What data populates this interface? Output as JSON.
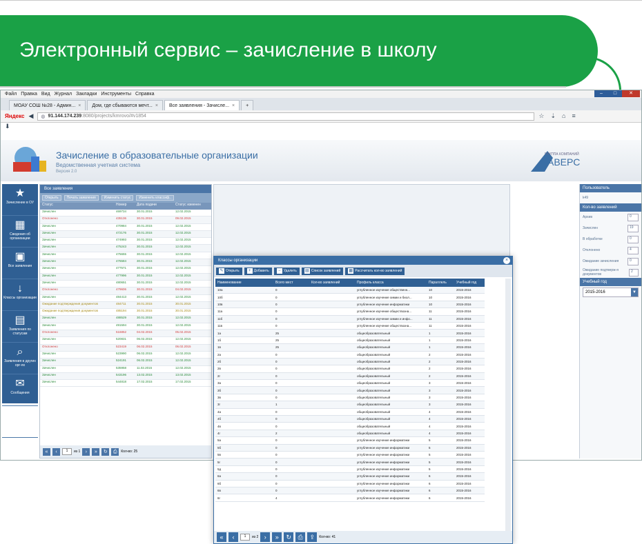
{
  "slide_title": "Электронный сервис – зачисление в школу",
  "browser": {
    "menu": [
      "Файл",
      "Правка",
      "Вид",
      "Журнал",
      "Закладки",
      "Инструменты",
      "Справка"
    ],
    "tabs": [
      "МОАУ СОШ №28 - Админ...",
      "Дом, где сбываются мечт...",
      "Все заявления - Зачисле..."
    ],
    "address_brand": "Яндекс",
    "url_host": "91.144.174.239",
    "url_path": ":8080/projects/kmrovo/#v1854"
  },
  "app": {
    "title": "Зачисление в образовательные организации",
    "subtitle": "Ведомственная учетная система",
    "version": "Версия 2.0",
    "avers_label": "ГРУППА КОМПАНИЙ",
    "avers_name": "АВЕРС"
  },
  "sidebar": [
    {
      "icon": "★",
      "label": "Зачисление в ОУ"
    },
    {
      "icon": "▦",
      "label": "Сведения об организации"
    },
    {
      "icon": "▣",
      "label": "Все заявления"
    },
    {
      "icon": "↓",
      "label": "Классы организации"
    },
    {
      "icon": "▤",
      "label": "Заявления по статусам"
    },
    {
      "icon": "⌕",
      "label": "Заявления в других орг-ях"
    },
    {
      "icon": "✉",
      "label": "Сообщения"
    },
    {
      "icon": "⇥",
      "label": "Выход"
    }
  ],
  "left_panel": {
    "header": "Все заявления",
    "tools": [
      "Открыть",
      "Печать заявления",
      "Изменить статус",
      "Изменить классиф.."
    ],
    "cols": [
      "Статус",
      "Номер",
      "Дата подачи",
      "Статус изменен"
    ],
    "rows": [
      [
        "Зачислен",
        "469734",
        "30.01.2015",
        "12.02.2015",
        "ok"
      ],
      [
        "Отклонено",
        "435136",
        "30.01.2015",
        "09.02.2015",
        "bad"
      ],
      [
        "Зачислен",
        "470984",
        "30.01.2015",
        "12.02.2015",
        "ok"
      ],
      [
        "Зачислен",
        "472176",
        "30.01.2015",
        "12.02.2015",
        "ok"
      ],
      [
        "Зачислен",
        "474993",
        "30.01.2015",
        "12.02.2015",
        "ok"
      ],
      [
        "Зачислен",
        "475243",
        "30.01.2015",
        "12.02.2015",
        "ok"
      ],
      [
        "Зачислен",
        "475655",
        "30.01.2015",
        "12.02.2015",
        "ok"
      ],
      [
        "Зачислен",
        "476584",
        "30.01.2015",
        "12.02.2015",
        "ok"
      ],
      [
        "Зачислен",
        "477571",
        "30.01.2015",
        "12.02.2015",
        "ok"
      ],
      [
        "Зачислен",
        "477996",
        "30.01.2015",
        "12.02.2015",
        "ok"
      ],
      [
        "Зачислен",
        "480651",
        "30.01.2015",
        "12.02.2015",
        "ok"
      ],
      [
        "Отклонено",
        "479606",
        "30.01.2015",
        "04.02.2015",
        "bad"
      ],
      [
        "Зачислен",
        "484413",
        "30.01.2015",
        "12.02.2015",
        "ok"
      ],
      [
        "Ожидание подтверждения документов",
        "484711",
        "30.01.2015",
        "30.01.2015",
        "wait"
      ],
      [
        "Ожидание подтверждения документов",
        "485194",
        "30.01.2015",
        "30.01.2015",
        "wait"
      ],
      [
        "Зачислен",
        "488529",
        "30.01.2015",
        "12.02.2015",
        "ok"
      ],
      [
        "Зачислен",
        "491594",
        "30.01.2015",
        "12.02.2015",
        "ok"
      ],
      [
        "Отклонено",
        "516852",
        "04.02.2015",
        "05.02.2015",
        "bad"
      ],
      [
        "Зачислен",
        "520831",
        "06.02.2015",
        "12.02.2015",
        "ok"
      ],
      [
        "Отклонено",
        "523419",
        "06.02.2015",
        "06.02.2015",
        "bad"
      ],
      [
        "Зачислен",
        "523990",
        "06.02.2015",
        "12.02.2015",
        "ok"
      ],
      [
        "Зачислен",
        "524191",
        "06.02.2015",
        "12.02.2015",
        "ok"
      ],
      [
        "Зачислен",
        "535958",
        "11.02.2015",
        "12.02.2015",
        "ok"
      ],
      [
        "Зачислен",
        "543196",
        "13.02.2015",
        "13.02.2015",
        "ok"
      ],
      [
        "Зачислен",
        "544818",
        "17.02.2015",
        "17.02.2015",
        "ok"
      ]
    ],
    "pager_page": "1",
    "pager_of": "из 1",
    "pager_count": "Кол-во: 25"
  },
  "right_panel": {
    "user_head": "Пользователь",
    "user": "k49",
    "count_head": "Кол-во заявлений",
    "counts": [
      [
        "Архив",
        "0"
      ],
      [
        "Зачислен",
        "19"
      ],
      [
        "В обработке",
        "0"
      ],
      [
        "Отклонено",
        "4"
      ],
      [
        "Ожидание зачисления",
        "0"
      ],
      [
        "Ожидание подтверж-я документов",
        "2"
      ]
    ],
    "year_head": "Учебный год",
    "year": "2015-2016"
  },
  "modal": {
    "title": "Классы организации",
    "tools": [
      "Открыть",
      "Добавить",
      "Удалить",
      "Список заявлений",
      "Рассчитать кол-во заявлений"
    ],
    "cols": [
      "Наименование",
      "Всего мест",
      "Кол-во заявлений",
      "Профиль класса",
      "Параллель",
      "Учебный год"
    ],
    "rows": [
      [
        "10а",
        "0",
        "",
        "углубленное изучение общественн...",
        "10",
        "2015-2016"
      ],
      [
        "10б",
        "0",
        "",
        "углубленное изучение химии и биол...",
        "10",
        "2015-2016"
      ],
      [
        "10в",
        "0",
        "",
        "углубленное изучение информатики",
        "10",
        "2015-2016"
      ],
      [
        "11а",
        "0",
        "",
        "углубленное изучение обществозна...",
        "11",
        "2015-2016"
      ],
      [
        "11б",
        "0",
        "",
        "углубленное изучение химии и инфо...",
        "11",
        "2015-2016"
      ],
      [
        "11в",
        "0",
        "",
        "углубленное изучение обществозна...",
        "11",
        "2015-2016"
      ],
      [
        "1а",
        "25",
        "",
        "общеобразовательный",
        "1",
        "2015-2016"
      ],
      [
        "1б",
        "25",
        "",
        "общеобразовательный",
        "1",
        "2015-2016"
      ],
      [
        "1в",
        "25",
        "",
        "общеобразовательный",
        "1",
        "2015-2016"
      ],
      [
        "2а",
        "0",
        "",
        "общеобразовательный",
        "2",
        "2015-2016"
      ],
      [
        "2б",
        "0",
        "",
        "общеобразовательный",
        "2",
        "2015-2016"
      ],
      [
        "2в",
        "0",
        "",
        "общеобразовательный",
        "2",
        "2015-2016"
      ],
      [
        "2г",
        "0",
        "",
        "общеобразовательный",
        "2",
        "2015-2016"
      ],
      [
        "3а",
        "0",
        "",
        "общеобразовательный",
        "3",
        "2015-2016"
      ],
      [
        "3б",
        "0",
        "",
        "общеобразовательный",
        "3",
        "2015-2016"
      ],
      [
        "3в",
        "0",
        "",
        "общеобразовательный",
        "3",
        "2015-2016"
      ],
      [
        "3г",
        "1",
        "",
        "общеобразовательный",
        "3",
        "2015-2016"
      ],
      [
        "4а",
        "0",
        "",
        "общеобразовательный",
        "4",
        "2015-2016"
      ],
      [
        "4б",
        "0",
        "",
        "общеобразовательный",
        "4",
        "2015-2016"
      ],
      [
        "4в",
        "0",
        "",
        "общеобразовательный",
        "4",
        "2015-2016"
      ],
      [
        "4г",
        "2",
        "",
        "общеобразовательный",
        "4",
        "2015-2016"
      ],
      [
        "5а",
        "0",
        "",
        "углубленное изучение информатики",
        "5",
        "2015-2016"
      ],
      [
        "5б",
        "0",
        "",
        "углубленное изучение информатики",
        "5",
        "2015-2016"
      ],
      [
        "5в",
        "0",
        "",
        "углубленное изучение информатики",
        "5",
        "2015-2016"
      ],
      [
        "5г",
        "0",
        "",
        "углубленное изучение информатики",
        "5",
        "2015-2016"
      ],
      [
        "5д",
        "0",
        "",
        "углубленное изучение информатики",
        "5",
        "2015-2016"
      ],
      [
        "6а",
        "0",
        "",
        "углубленное изучение информатики",
        "6",
        "2015-2016"
      ],
      [
        "6б",
        "0",
        "",
        "углубленное изучение информатики",
        "6",
        "2015-2016"
      ],
      [
        "6в",
        "0",
        "",
        "углубленное изучение информатики",
        "6",
        "2015-2016"
      ],
      [
        "6г",
        "4",
        "",
        "углубленное изучение информатики",
        "6",
        "2015-2016"
      ]
    ],
    "pager_page": "1",
    "pager_of": "из 2",
    "pager_count": "Кол-во: 41"
  }
}
